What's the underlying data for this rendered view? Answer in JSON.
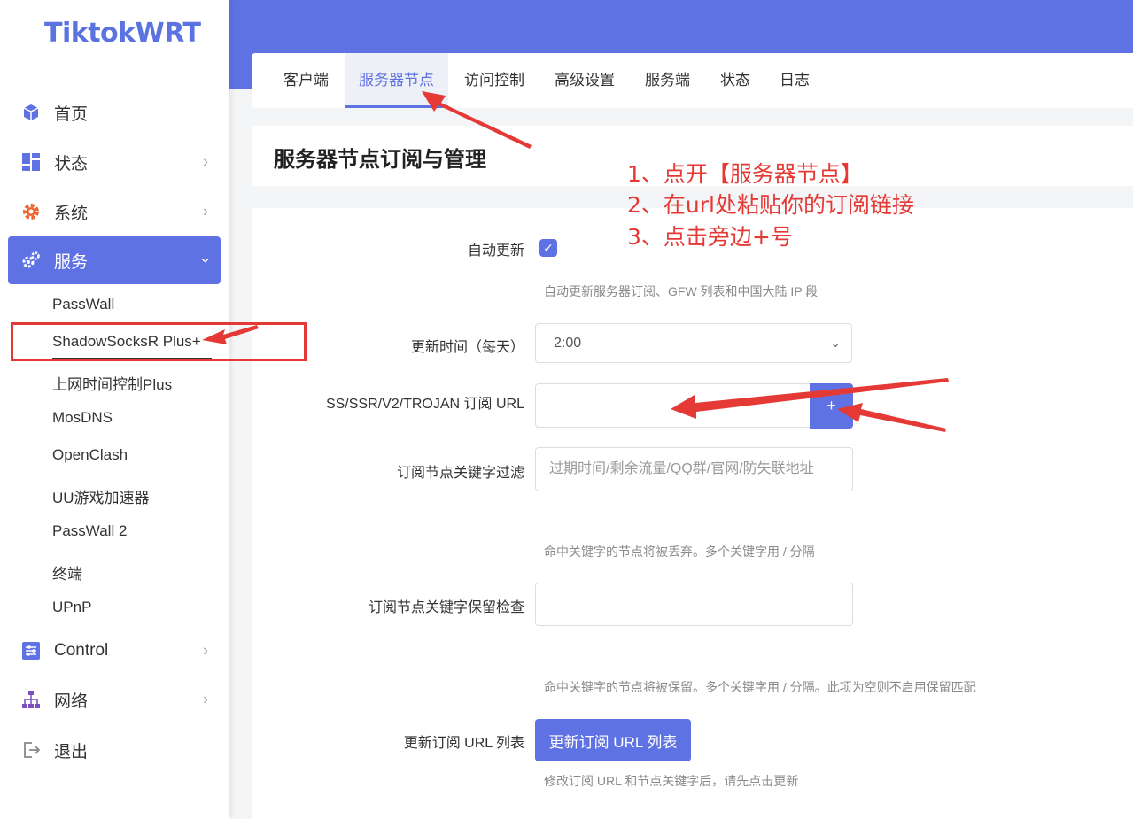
{
  "app": {
    "logo": "TiktokWRT"
  },
  "sidebar": {
    "items": [
      {
        "label": "首页",
        "icon": "cube-icon"
      },
      {
        "label": "状态",
        "icon": "dashboard-icon"
      },
      {
        "label": "系统",
        "icon": "gear-icon"
      },
      {
        "label": "服务",
        "icon": "cogs-icon",
        "active": true
      },
      {
        "label": "Control",
        "icon": "sliders-icon"
      },
      {
        "label": "网络",
        "icon": "sitemap-icon"
      },
      {
        "label": "退出",
        "icon": "logout-icon"
      }
    ],
    "subitems": [
      "PassWall",
      "ShadowSocksR Plus+",
      "上网时间控制Plus",
      "MosDNS",
      "OpenClash",
      "UU游戏加速器",
      "PassWall 2",
      "终端",
      "UPnP"
    ]
  },
  "tabs": [
    "客户端",
    "服务器节点",
    "访问控制",
    "高级设置",
    "服务端",
    "状态",
    "日志"
  ],
  "page": {
    "title": "服务器节点订阅与管理"
  },
  "form": {
    "auto_update": {
      "label": "自动更新",
      "help": "自动更新服务器订阅、GFW 列表和中国大陆 IP 段"
    },
    "update_time": {
      "label": "更新时间（每天）",
      "value": "2:00"
    },
    "sub_url": {
      "label": "SS/SSR/V2/TROJAN 订阅 URL",
      "button": "+"
    },
    "filter": {
      "label": "订阅节点关键字过滤",
      "placeholder": "过期时间/剩余流量/QQ群/官网/防失联地址",
      "help": "命中关键字的节点将被丢弃。多个关键字用 / 分隔"
    },
    "keep": {
      "label": "订阅节点关键字保留检查",
      "help": "命中关键字的节点将被保留。多个关键字用 / 分隔。此项为空则不启用保留匹配"
    },
    "refresh": {
      "label": "更新订阅 URL 列表",
      "button": "更新订阅 URL 列表",
      "help": "修改订阅 URL 和节点关键字后，请先点击更新"
    }
  },
  "annotations": [
    "1、点开【服务器节点】",
    "2、在url处粘贴你的订阅链接",
    "3、点击旁边+号"
  ],
  "colors": {
    "accent": "#5e72e4",
    "annotation": "#e53935"
  }
}
